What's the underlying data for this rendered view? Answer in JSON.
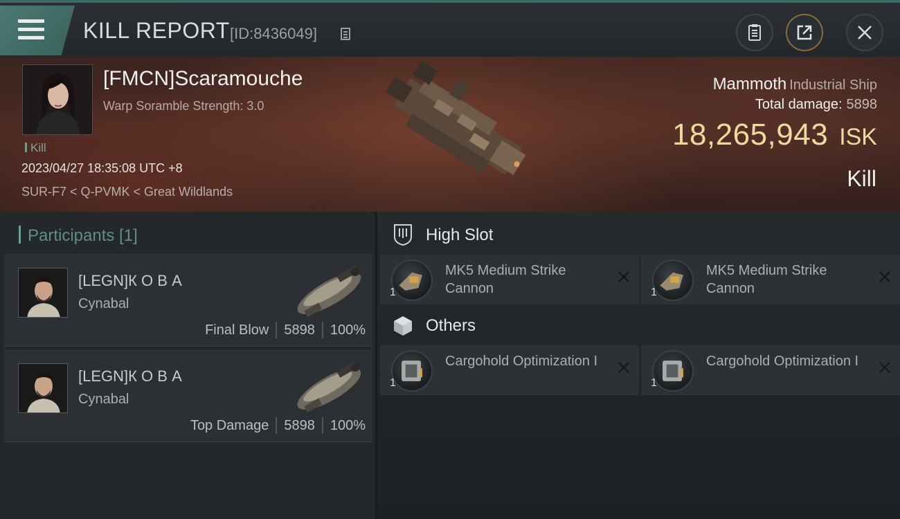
{
  "header": {
    "title": "KILL REPORT",
    "report_id": "[ID:8436049]"
  },
  "victim": {
    "name": "[FMCN]Scaramouche",
    "warp_scramble": "Warp Soramble Strength: 3.0",
    "tag": "Kill",
    "timestamp": "2023/04/27 18:35:08 UTC +8",
    "location": "SUR-F7 < Q-PVMK < Great Wildlands",
    "ship_name": "Mammoth",
    "ship_class": "Industrial Ship",
    "total_damage_label": "Total damage:",
    "total_damage_value": "5898",
    "isk_value": "18,265,943",
    "isk_unit": "ISK",
    "result": "Kill"
  },
  "participants": {
    "header": "Participants [1]",
    "rows": [
      {
        "name": "[LEGN]К О В А",
        "ship": "Cynabal",
        "role": "Final Blow",
        "damage": "5898",
        "percent": "100%"
      },
      {
        "name": "[LEGN]К О В А",
        "ship": "Cynabal",
        "role": "Top Damage",
        "damage": "5898",
        "percent": "100%"
      }
    ]
  },
  "fitting": {
    "high_slot": {
      "title": "High Slot",
      "items": [
        {
          "name": "MK5 Medium Strike Cannon",
          "qty": "1"
        },
        {
          "name": "MK5 Medium Strike Cannon",
          "qty": "1"
        }
      ]
    },
    "others": {
      "title": "Others",
      "items": [
        {
          "name": "Cargohold Optimization I",
          "qty": "1"
        },
        {
          "name": "Cargohold Optimization I",
          "qty": "1"
        }
      ]
    }
  },
  "colors": {
    "accent_teal": "#4b7a72",
    "isk_gold": "#f1d9a2"
  }
}
